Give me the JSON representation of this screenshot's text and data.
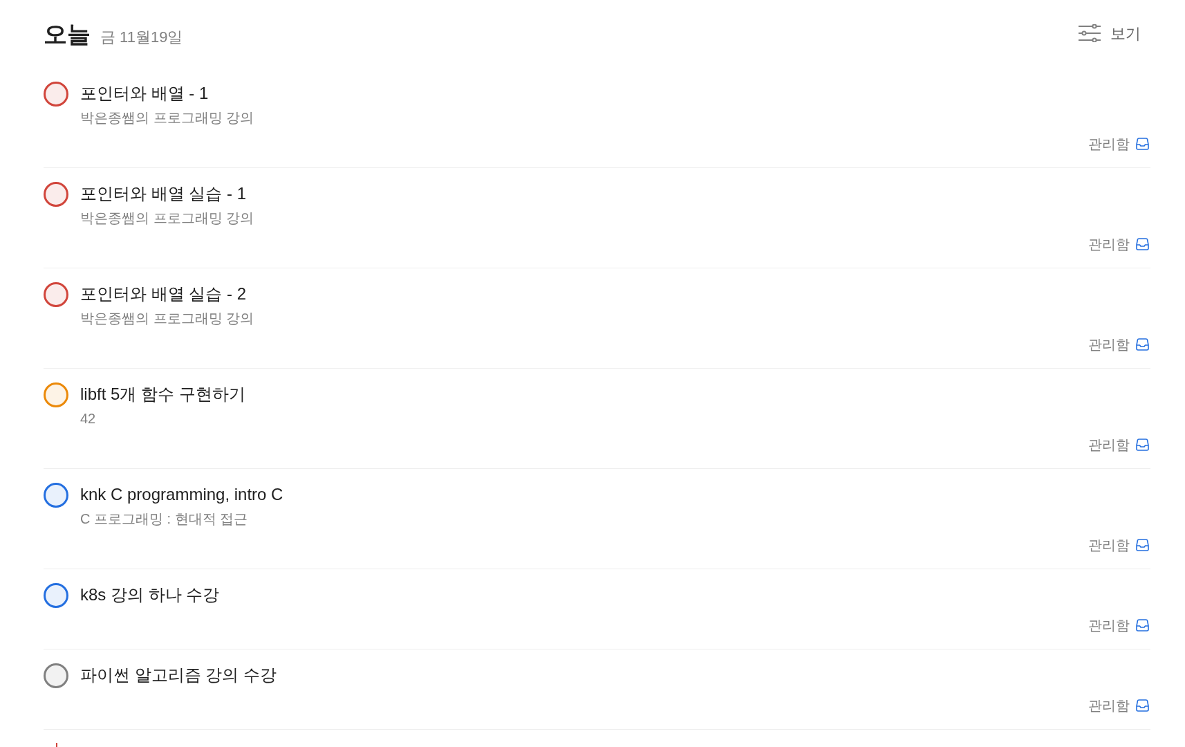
{
  "header": {
    "title": "오늘",
    "date": "금 11월19일"
  },
  "view_button": {
    "label": "보기"
  },
  "tasks": [
    {
      "title": "포인터와 배열 - 1",
      "description": "박은종쌤의 프로그래밍 강의",
      "color": "#d1453b",
      "project": "관리함"
    },
    {
      "title": "포인터와 배열 실습 - 1",
      "description": "박은종쌤의 프로그래밍 강의",
      "color": "#d1453b",
      "project": "관리함"
    },
    {
      "title": "포인터와 배열 실습 - 2",
      "description": "박은종쌤의 프로그래밍 강의",
      "color": "#d1453b",
      "project": "관리함"
    },
    {
      "title": "libft 5개 함수 구현하기",
      "description": "42",
      "color": "#eb8909",
      "project": "관리함"
    },
    {
      "title": "knk C programming, intro C",
      "description": "C 프로그래밍 : 현대적 접근",
      "color": "#246fe0",
      "project": "관리함"
    },
    {
      "title": "k8s 강의 하나 수강",
      "color": "#246fe0",
      "project": "관리함"
    },
    {
      "title": "파이썬 알고리즘 강의 수강",
      "color": "#808080",
      "project": "관리함"
    }
  ]
}
